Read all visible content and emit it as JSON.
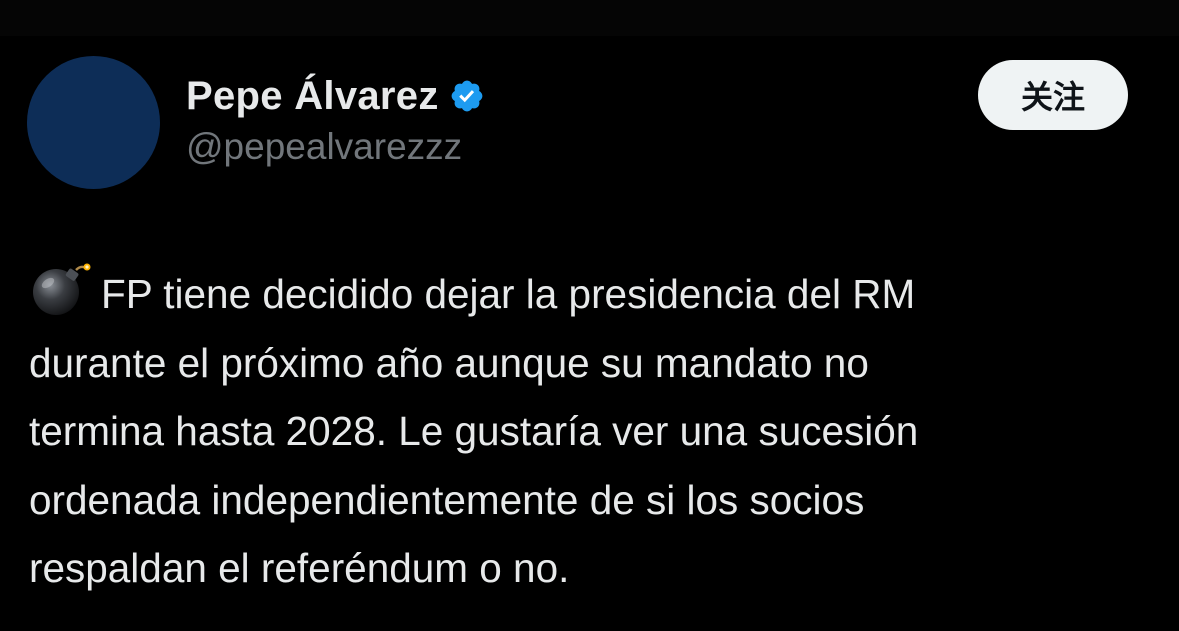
{
  "author": {
    "display_name": "Pepe Álvarez",
    "handle": "@pepealvarezzz",
    "verified": true,
    "avatar_color": "#0d2d57"
  },
  "follow_button": {
    "label": "关注"
  },
  "tweet": {
    "leading_icon": "bomb-emoji",
    "lines": [
      "FP tiene decidido dejar la presidencia del RM",
      "durante el próximo año aunque su mandato no",
      "termina hasta 2028. Le gustaría ver una sucesión",
      "ordenada independientemente de si los socios",
      "respaldan el referéndum o no."
    ]
  },
  "colors": {
    "background": "#000000",
    "primary_text": "#e7e9ea",
    "secondary_text": "#71767b",
    "verified_badge": "#1d9bf0",
    "follow_button_bg": "#eff3f4"
  }
}
